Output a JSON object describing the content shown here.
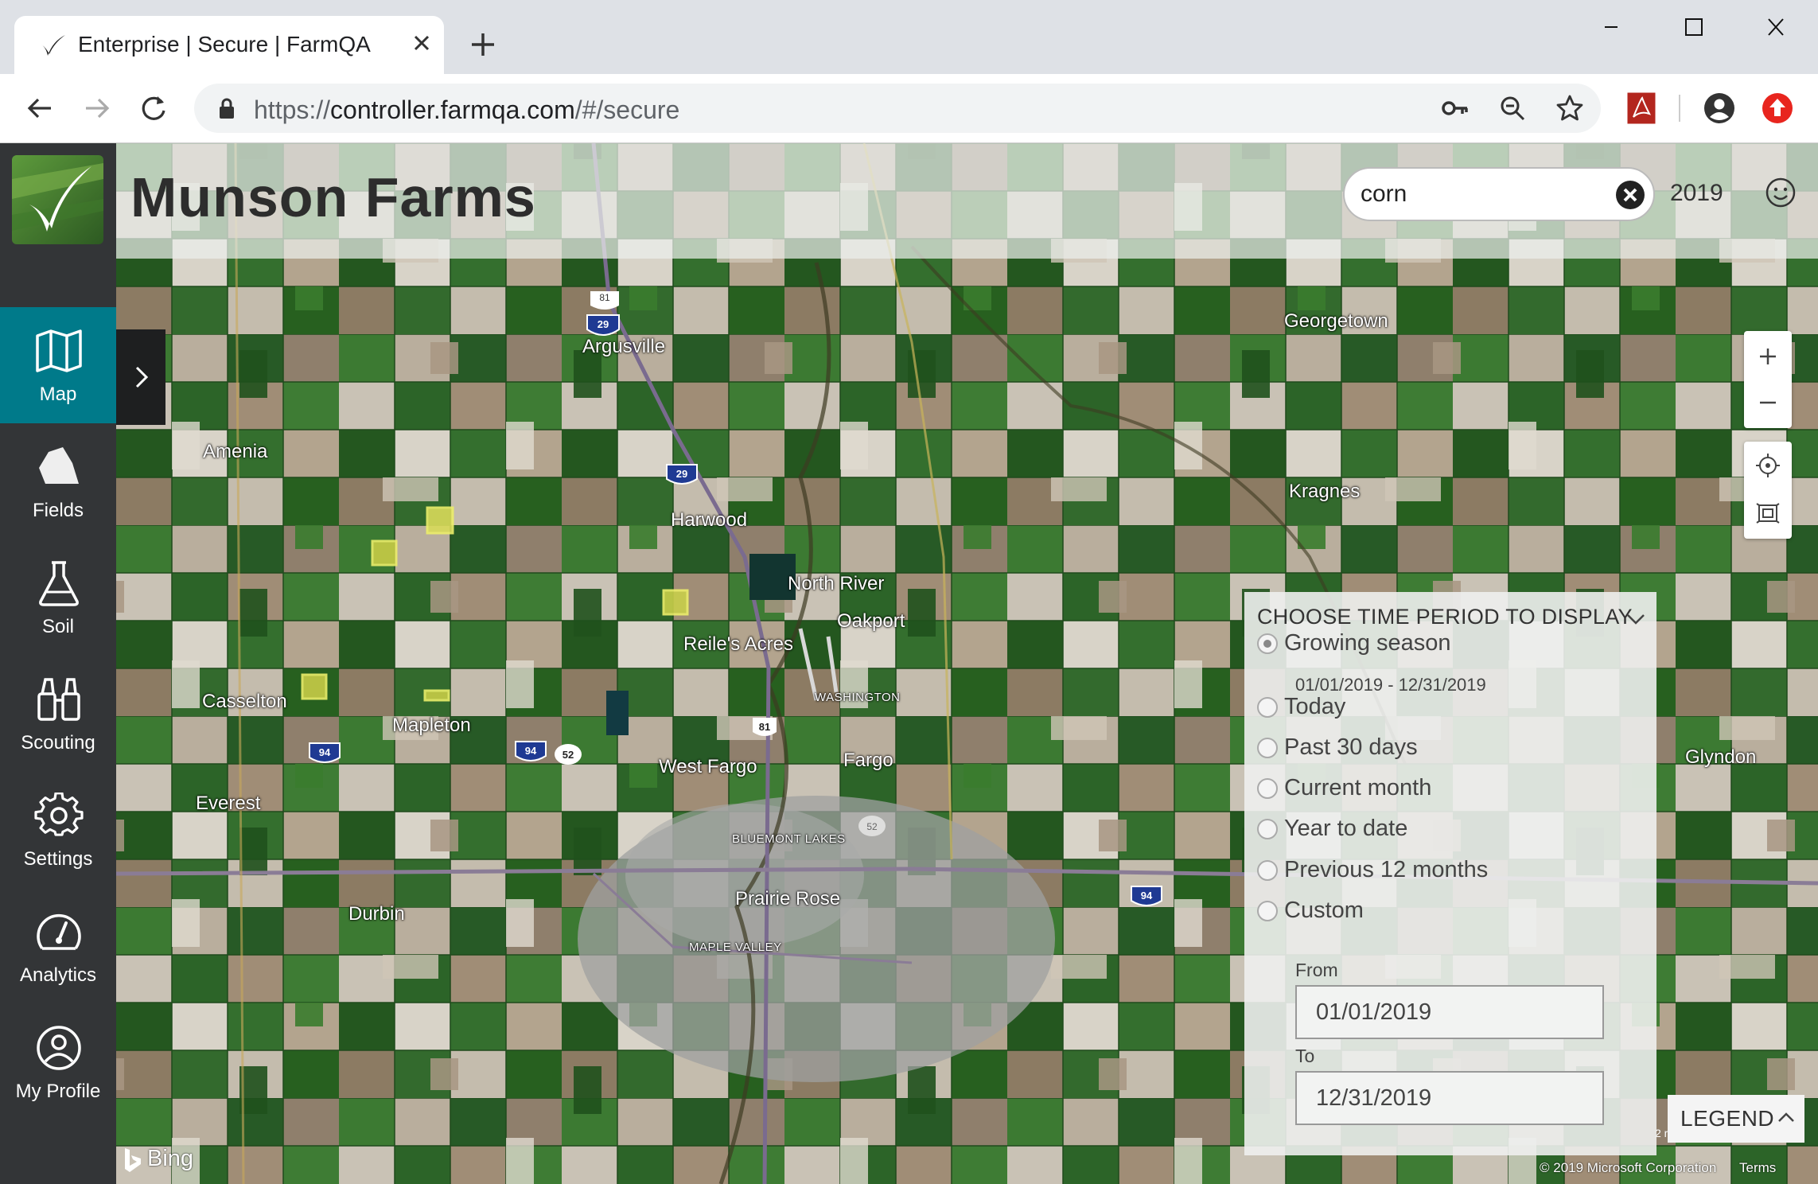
{
  "browser": {
    "tab_title": "Enterprise | Secure | FarmQA",
    "url_scheme": "https://",
    "url_host": "controller.farmqa.com",
    "url_path": "/#/secure"
  },
  "header": {
    "title": "Munson Farms",
    "search_value": "corn",
    "year": "2019"
  },
  "sidebar": {
    "items": [
      {
        "label": "Map",
        "icon": "map-icon",
        "active": true
      },
      {
        "label": "Fields",
        "icon": "fields-icon"
      },
      {
        "label": "Soil",
        "icon": "flask-icon"
      },
      {
        "label": "Scouting",
        "icon": "binoculars-icon"
      },
      {
        "label": "Settings",
        "icon": "gear-icon"
      },
      {
        "label": "Analytics",
        "icon": "gauge-icon"
      },
      {
        "label": "My Profile",
        "icon": "user-circle-icon"
      }
    ]
  },
  "map": {
    "places": [
      {
        "name": "Georgetown"
      },
      {
        "name": "Argusville"
      },
      {
        "name": "Amenia"
      },
      {
        "name": "Kragnes"
      },
      {
        "name": "Harwood"
      },
      {
        "name": "North River"
      },
      {
        "name": "Oakport"
      },
      {
        "name": "Reile's Acres"
      },
      {
        "name": "Casselton"
      },
      {
        "name": "Mapleton"
      },
      {
        "name": "WASHINGTON"
      },
      {
        "name": "West Fargo"
      },
      {
        "name": "Fargo"
      },
      {
        "name": "Glyndon"
      },
      {
        "name": "Everest"
      },
      {
        "name": "BLUEMONT LAKES"
      },
      {
        "name": "Prairie Rose"
      },
      {
        "name": "Durbin"
      },
      {
        "name": "MAPLE VALLEY"
      }
    ],
    "shields": [
      "81",
      "29",
      "29",
      "94",
      "94",
      "52",
      "81",
      "52",
      "94"
    ],
    "attribution": "© 2019 Microsoft Corporation",
    "terms": "Terms",
    "bing": "Bing",
    "scale": "2 miles"
  },
  "time_panel": {
    "title": "CHOOSE TIME PERIOD TO DISPLAY",
    "options": [
      {
        "label": "Growing season",
        "checked": true
      },
      {
        "label": "Today"
      },
      {
        "label": "Past 30 days"
      },
      {
        "label": "Current month"
      },
      {
        "label": "Year to date"
      },
      {
        "label": "Previous 12 months"
      },
      {
        "label": "Custom"
      }
    ],
    "growing_range": "01/01/2019 - 12/31/2019",
    "from_label": "From",
    "from_value": "01/01/2019",
    "to_label": "To",
    "to_value": "12/31/2019"
  },
  "legend": {
    "label": "LEGEND"
  },
  "colors": {
    "accent": "#007a8a",
    "sidebar": "#333537"
  }
}
